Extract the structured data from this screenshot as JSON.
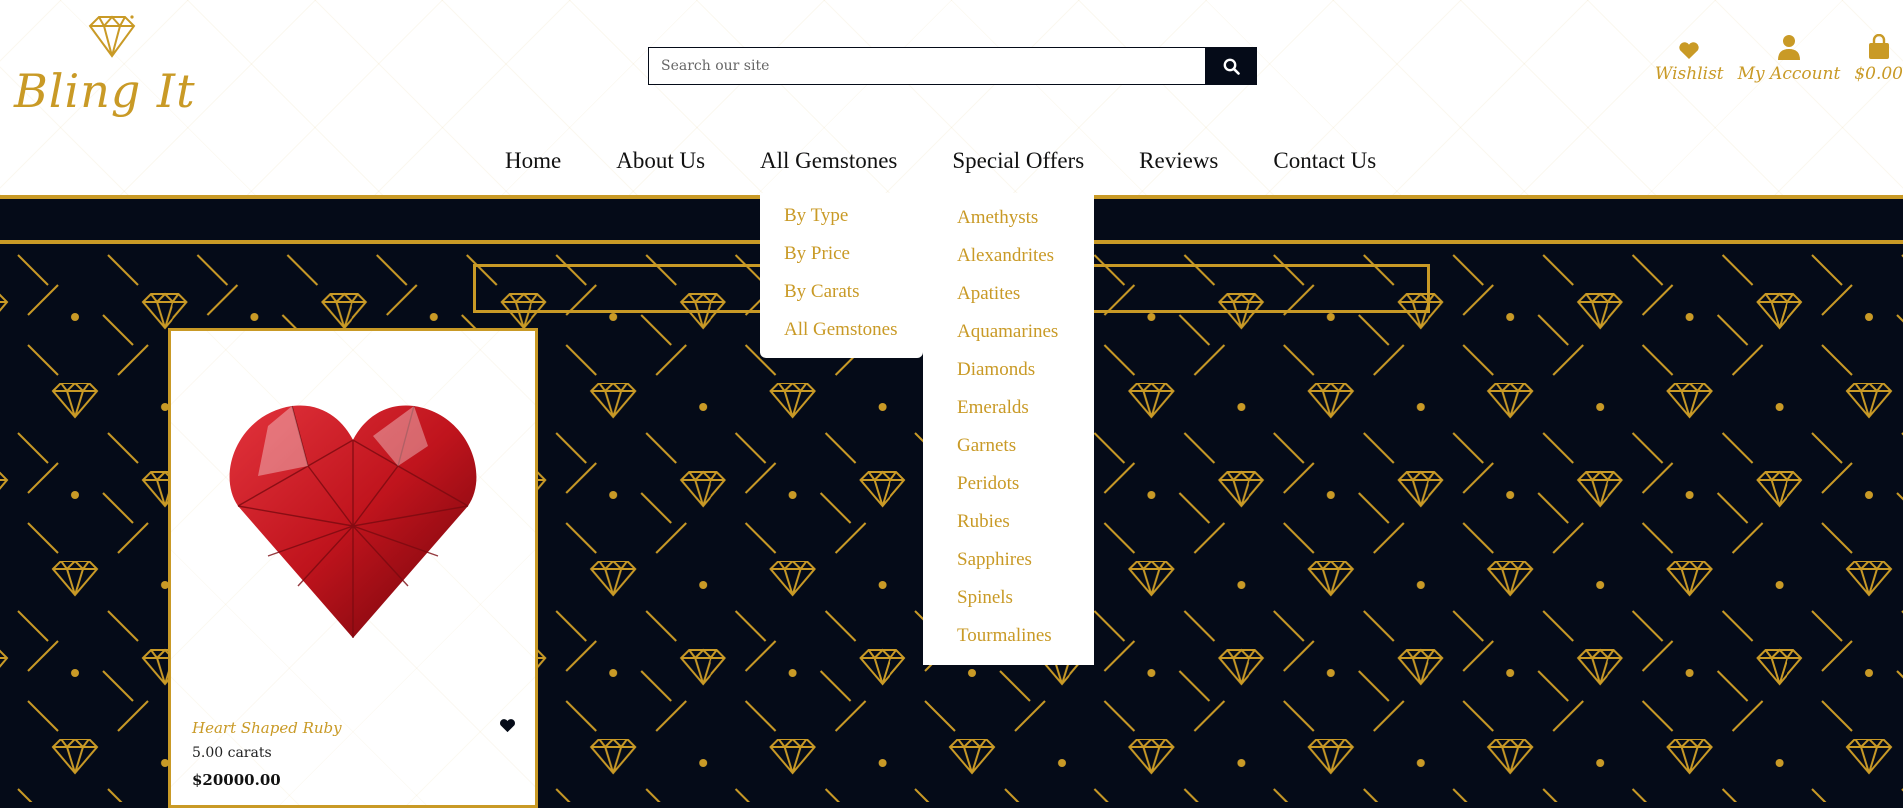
{
  "brand": {
    "name": "Bling It"
  },
  "search": {
    "placeholder": "Search our site"
  },
  "utilities": [
    {
      "label": "Wishlist",
      "icon": "heart-icon"
    },
    {
      "label": "My Account",
      "icon": "user-icon"
    },
    {
      "label": "$0.00",
      "icon": "shopping-bag-icon"
    }
  ],
  "nav": [
    "Home",
    "About Us",
    "All Gemstones",
    "Special Offers",
    "Reviews",
    "Contact Us"
  ],
  "dropdown": {
    "left": [
      "By Type",
      "By Price",
      "By Carats",
      "All Gemstones"
    ],
    "right": [
      "Amethysts",
      "Alexandrites",
      "Apatites",
      "Aquamarines",
      "Diamonds",
      "Emeralds",
      "Garnets",
      "Peridots",
      "Rubies",
      "Sapphires",
      "Spinels",
      "Tourmalines"
    ]
  },
  "product": {
    "title": "Heart Shaped Ruby",
    "carats": "5.00 carats",
    "price": "$20000.00",
    "icon": "heart-icon"
  },
  "colors": {
    "gold": "#c99a26",
    "navy": "#050b18",
    "white": "#ffffff"
  }
}
